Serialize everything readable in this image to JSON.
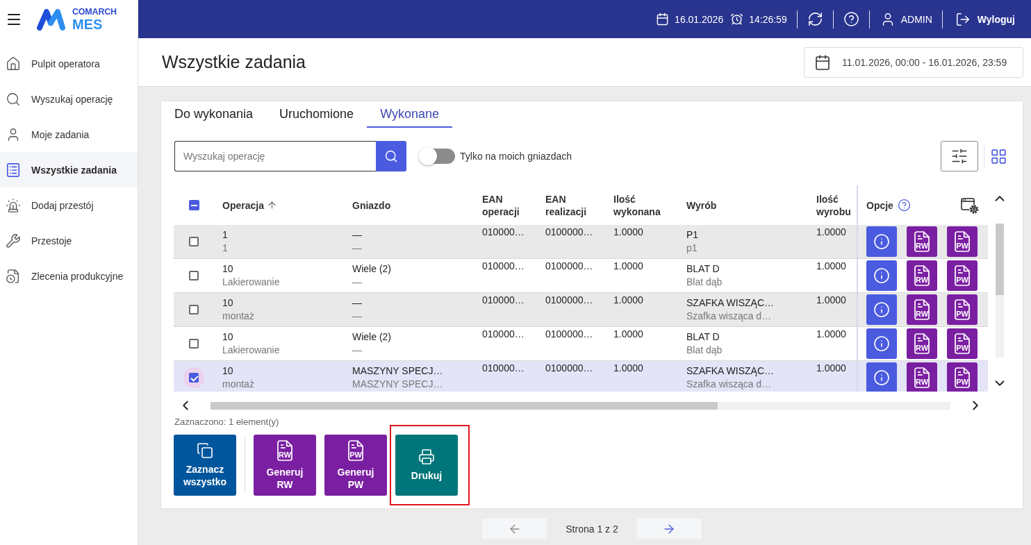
{
  "logo": {
    "brand": "COMARCH",
    "product": "MES"
  },
  "top_bar": {
    "date": "16.01.2026",
    "time": "14:26:59",
    "user": "ADMIN",
    "logout": "Wyloguj"
  },
  "sidebar": {
    "items": [
      {
        "label": "Pulpit operatora",
        "selected": false
      },
      {
        "label": "Wyszukaj operację",
        "selected": false
      },
      {
        "label": "Moje zadania",
        "selected": false
      },
      {
        "label": "Wszystkie zadania",
        "selected": true
      },
      {
        "label": "Dodaj przestój",
        "selected": false
      },
      {
        "label": "Przestoje",
        "selected": false
      },
      {
        "label": "Zlecenia produkcyjne",
        "selected": false
      }
    ]
  },
  "page": {
    "title": "Wszystkie zadania",
    "date_range": "11.01.2026, 00:00 - 16.01.2026, 23:59"
  },
  "tabs": [
    {
      "label": "Do wykonania",
      "selected": false
    },
    {
      "label": "Uruchomione",
      "selected": false
    },
    {
      "label": "Wykonane",
      "selected": true
    }
  ],
  "search": {
    "placeholder": "Wyszukaj operację"
  },
  "toggle": {
    "label": "Tylko na moich gniazdach",
    "on": false
  },
  "table": {
    "select_all": {
      "indeterminate": true
    },
    "columns": [
      {
        "label": "Operacja",
        "sorted": true
      },
      {
        "label": "Gniazdo",
        "sorted": false
      },
      {
        "label": "EAN operacji",
        "sorted": false
      },
      {
        "label": "EAN realizacji",
        "sorted": false
      },
      {
        "label": "Ilość wykonana",
        "sorted": false
      },
      {
        "label": "Wyrób",
        "sorted": false
      },
      {
        "label": "Ilość wyrobu",
        "sorted": false
      }
    ],
    "options_header": "Opcje",
    "rows": [
      {
        "selected": false,
        "operation": "1",
        "operation_name": "1",
        "workstation": "—",
        "workstation_detail": "—",
        "ean_operation": "010000…",
        "ean_realization": "0100000…",
        "quantity_done": "1.0000",
        "product": "P1",
        "product_name": "p1",
        "product_quantity": "1.0000",
        "actions": [
          {
            "kind": "info"
          },
          {
            "kind": "rw",
            "tag": "RW"
          },
          {
            "kind": "pw",
            "tag": "PW"
          }
        ]
      },
      {
        "selected": false,
        "operation": "10",
        "operation_name": "Lakierowanie",
        "workstation": "Wiele (2)",
        "workstation_detail": "—",
        "ean_operation": "010000…",
        "ean_realization": "0100000…",
        "quantity_done": "1.0000",
        "product": "BLAT D",
        "product_name": "Blat dąb",
        "product_quantity": "1.0000",
        "actions": [
          {
            "kind": "info"
          },
          {
            "kind": "rw",
            "tag": "RW"
          },
          {
            "kind": "pw",
            "tag": "PW"
          }
        ]
      },
      {
        "selected": false,
        "operation": "10",
        "operation_name": "montaż",
        "workstation": "—",
        "workstation_detail": "—",
        "ean_operation": "010000…",
        "ean_realization": "0100000…",
        "quantity_done": "1.0000",
        "product": "SZAFKA WISZĄC…",
        "product_name": "Szafka wisząca d…",
        "product_quantity": "1.0000",
        "actions": [
          {
            "kind": "info"
          },
          {
            "kind": "rw",
            "tag": "RW"
          },
          {
            "kind": "pw",
            "tag": "PW"
          }
        ]
      },
      {
        "selected": false,
        "operation": "10",
        "operation_name": "Lakierowanie",
        "workstation": "Wiele (2)",
        "workstation_detail": "—",
        "ean_operation": "010000…",
        "ean_realization": "0100000…",
        "quantity_done": "1.0000",
        "product": "BLAT D",
        "product_name": "Blat dąb",
        "product_quantity": "1.0000",
        "actions": [
          {
            "kind": "info"
          },
          {
            "kind": "rw",
            "tag": "RW"
          },
          {
            "kind": "pw",
            "tag": "PW"
          }
        ]
      },
      {
        "selected": true,
        "operation": "10",
        "operation_name": "montaż",
        "workstation": "MASZYNY SPECJ…",
        "workstation_detail": "MASZYNY SPECJ…",
        "ean_operation": "010000…",
        "ean_realization": "0100000…",
        "quantity_done": "1.0000",
        "product": "SZAFKA WISZĄC…",
        "product_name": "Szafka wisząca d…",
        "product_quantity": "1.0000",
        "actions": [
          {
            "kind": "info"
          },
          {
            "kind": "rw",
            "tag": "RW"
          },
          {
            "kind": "pw",
            "tag": "PW"
          }
        ]
      }
    ]
  },
  "selection": {
    "summary": "Zaznaczono: 1 element(y)"
  },
  "bulk_actions": [
    {
      "kind": "select_all",
      "label": "Zaznacz wszystko",
      "highlighted": false
    },
    {
      "kind": "rw",
      "label": "Generuj RW",
      "tag": "RW",
      "highlighted": false
    },
    {
      "kind": "pw",
      "label": "Generuj PW",
      "tag": "PW",
      "highlighted": false
    },
    {
      "kind": "print",
      "label": "Drukuj",
      "highlighted": true
    }
  ],
  "pagination": {
    "label": "Strona 1 z 2",
    "prev_disabled": true,
    "next_disabled": false
  }
}
